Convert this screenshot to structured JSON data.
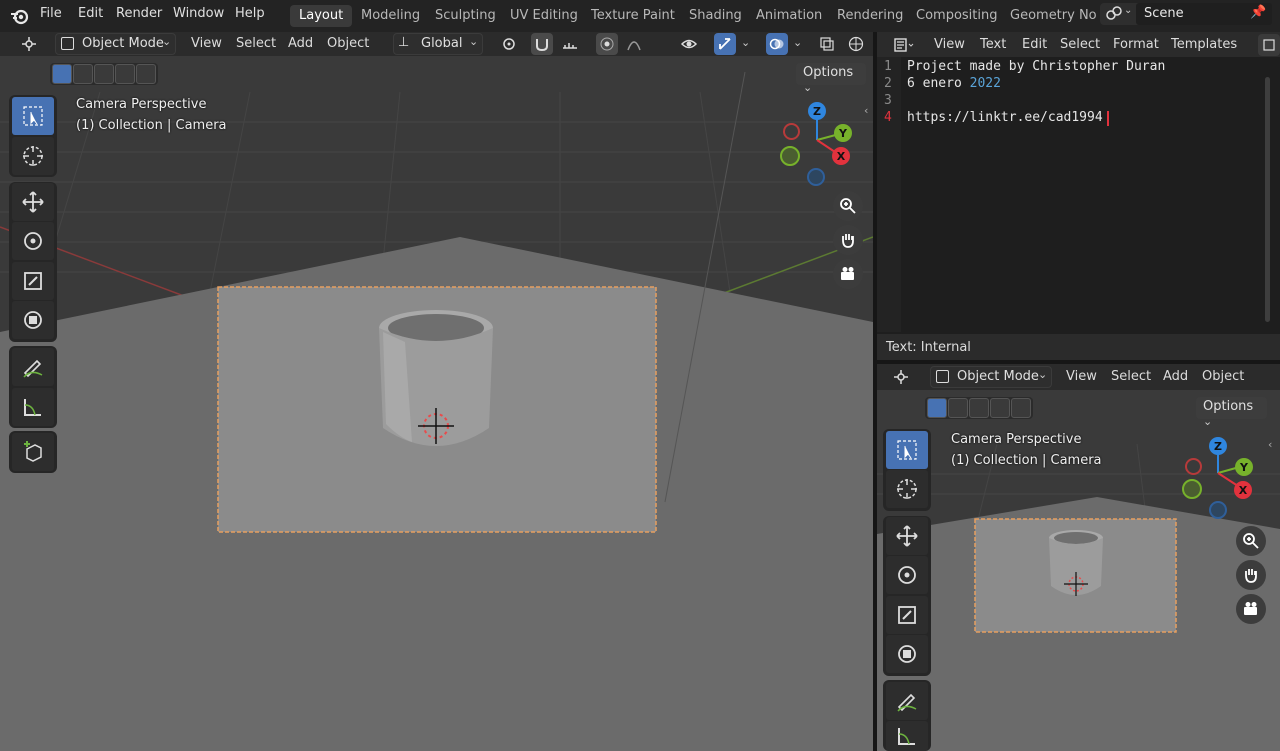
{
  "topbar": {
    "menus": [
      "File",
      "Edit",
      "Render",
      "Window",
      "Help"
    ],
    "workspaces": [
      "Layout",
      "Modeling",
      "Sculpting",
      "UV Editing",
      "Texture Paint",
      "Shading",
      "Animation",
      "Rendering",
      "Compositing",
      "Geometry Noc"
    ],
    "active_workspace": "Layout",
    "scene_name": "Scene"
  },
  "main_viewport": {
    "mode": "Object Mode",
    "menus": [
      "View",
      "Select",
      "Add",
      "Object"
    ],
    "orientation": "Global",
    "options_label": "Options",
    "overlay_line1": "Camera Perspective",
    "overlay_line2": "(1) Collection | Camera"
  },
  "text_editor": {
    "menus": [
      "View",
      "Text",
      "Edit",
      "Select",
      "Format",
      "Templates"
    ],
    "lines": [
      {
        "num": "1",
        "text": "Project made by Christopher Duran"
      },
      {
        "num": "2",
        "word": "6 enero ",
        "year": "2022"
      },
      {
        "num": "3",
        "text": ""
      },
      {
        "num": "4",
        "text": "https://linktr.ee/cad1994"
      }
    ],
    "status": "Text: Internal"
  },
  "small_viewport": {
    "mode": "Object Mode",
    "menus": [
      "View",
      "Select",
      "Add",
      "Object"
    ],
    "options_label": "Options",
    "overlay_line1": "Camera Perspective",
    "overlay_line2": "(1) Collection | Camera"
  },
  "gizmo": {
    "x": "X",
    "y": "Y",
    "z": "Z"
  },
  "colors": {
    "accent": "#4772b3",
    "x_axis": "#e2323d",
    "y_axis": "#77b22b",
    "z_axis": "#2f86df",
    "line4_number": "#e2323d",
    "year_number": "#5aa4d8"
  }
}
